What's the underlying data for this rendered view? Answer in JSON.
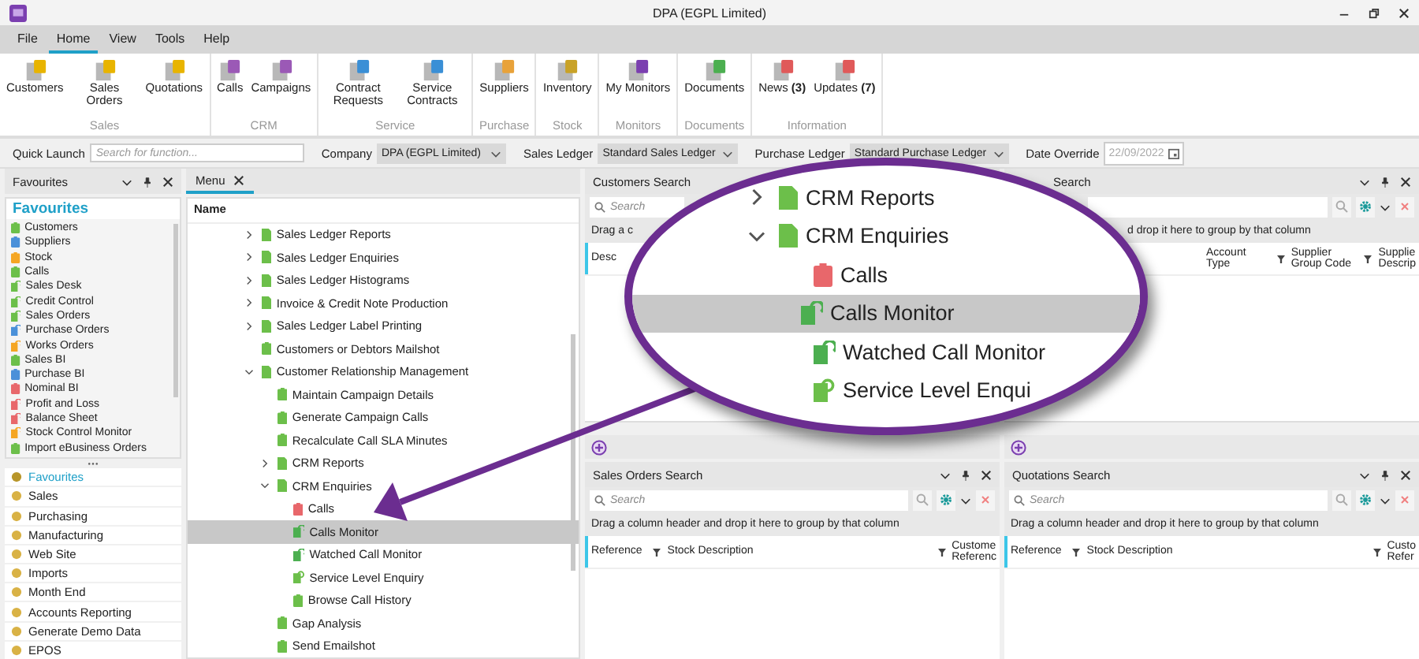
{
  "window": {
    "title": "DPA (EGPL Limited)"
  },
  "menu_tabs": [
    {
      "label": "File",
      "selected": false
    },
    {
      "label": "Home",
      "selected": true
    },
    {
      "label": "View",
      "selected": false
    },
    {
      "label": "Tools",
      "selected": false
    },
    {
      "label": "Help",
      "selected": false
    }
  ],
  "ribbon": {
    "groups": [
      {
        "label": "Sales",
        "buttons": [
          "Customers",
          "Sales Orders",
          "Quotations"
        ]
      },
      {
        "label": "CRM",
        "buttons": [
          "Calls",
          "Campaigns"
        ]
      },
      {
        "label": "Service",
        "buttons": [
          "Contract Requests",
          "Service Contracts"
        ]
      },
      {
        "label": "Purchase",
        "buttons": [
          "Suppliers"
        ]
      },
      {
        "label": "Stock",
        "buttons": [
          "Inventory"
        ]
      },
      {
        "label": "Monitors",
        "buttons": [
          "My Monitors"
        ]
      },
      {
        "label": "Documents",
        "buttons": [
          "Documents"
        ]
      },
      {
        "label": "Information",
        "buttons": [
          "News **(3)**",
          "Updates **(7)**"
        ]
      }
    ]
  },
  "quick_bar": {
    "quick_launch": {
      "label": "Quick Launch",
      "placeholder": "Search for function..."
    },
    "selectors": [
      {
        "label": "Company",
        "value": "DPA (EGPL Limited)"
      },
      {
        "label": "Sales Ledger",
        "value": "Standard Sales Ledger"
      },
      {
        "label": "Purchase Ledger",
        "value": "Standard Purchase Ledger"
      }
    ],
    "date_override": {
      "label": "Date Override",
      "value": "22/09/2022",
      "disabled": true
    }
  },
  "favourites_panel": {
    "title": "Favourites",
    "heading": "Favourites",
    "items": [
      {
        "label": "Customers",
        "kind": "task",
        "color": "#6cbf4a"
      },
      {
        "label": "Suppliers",
        "kind": "task",
        "color": "#4a90d9"
      },
      {
        "label": "Stock",
        "kind": "task",
        "color": "#f5a623"
      },
      {
        "label": "Calls",
        "kind": "task",
        "color": "#6cbf4a"
      },
      {
        "label": "Sales Desk",
        "kind": "monitor",
        "color": "#6cbf4a"
      },
      {
        "label": "Credit Control",
        "kind": "monitor",
        "color": "#6cbf4a"
      },
      {
        "label": "Sales Orders",
        "kind": "monitor",
        "color": "#6cbf4a"
      },
      {
        "label": "Purchase Orders",
        "kind": "monitor",
        "color": "#4a90d9"
      },
      {
        "label": "Works Orders",
        "kind": "monitor",
        "color": "#f5a623"
      },
      {
        "label": "Sales BI",
        "kind": "task",
        "color": "#6cbf4a"
      },
      {
        "label": "Purchase BI",
        "kind": "task",
        "color": "#4a90d9"
      },
      {
        "label": "Nominal BI",
        "kind": "task",
        "color": "#e8676b"
      },
      {
        "label": "Profit and Loss",
        "kind": "monitor",
        "color": "#e8676b"
      },
      {
        "label": "Balance Sheet",
        "kind": "monitor",
        "color": "#e8676b"
      },
      {
        "label": "Stock Control Monitor",
        "kind": "monitor",
        "color": "#f5a623"
      },
      {
        "label": "Import eBusiness Orders",
        "kind": "task",
        "color": "#6cbf4a"
      }
    ],
    "nav": [
      {
        "label": "Favourites",
        "selected": true
      },
      {
        "label": "Sales",
        "selected": false
      },
      {
        "label": "Purchasing",
        "selected": false
      },
      {
        "label": "Manufacturing",
        "selected": false
      },
      {
        "label": "Web Site",
        "selected": false
      },
      {
        "label": "Imports",
        "selected": false
      },
      {
        "label": "Month End",
        "selected": false
      },
      {
        "label": "Accounts Reporting",
        "selected": false
      },
      {
        "label": "Generate Demo Data",
        "selected": false
      },
      {
        "label": "EPOS",
        "selected": false
      }
    ]
  },
  "menu_panel": {
    "tab": "Menu",
    "column": "Name",
    "tree": [
      {
        "label": "Sales Ledger Reports",
        "kind": "folder",
        "expanded": false,
        "selected": false,
        "color": "#6cbf4a"
      },
      {
        "label": "Sales Ledger Enquiries",
        "kind": "folder",
        "expanded": false,
        "selected": false,
        "color": "#6cbf4a"
      },
      {
        "label": "Sales Ledger Histograms",
        "kind": "folder",
        "expanded": false,
        "selected": false,
        "color": "#6cbf4a"
      },
      {
        "label": "Invoice & Credit Note Production",
        "kind": "folder",
        "expanded": false,
        "selected": false,
        "color": "#6cbf4a"
      },
      {
        "label": "Sales Ledger Label Printing",
        "kind": "folder",
        "expanded": false,
        "selected": false,
        "color": "#6cbf4a"
      },
      {
        "label": "Customers or Debtors Mailshot",
        "kind": "task",
        "selected": false,
        "color": "#6cbf4a"
      },
      {
        "label": "Customer Relationship Management",
        "kind": "folder",
        "expanded": true,
        "selected": false,
        "color": "#6cbf4a",
        "children": [
          {
            "label": "Maintain Campaign Details",
            "kind": "task",
            "selected": false,
            "color": "#6cbf4a"
          },
          {
            "label": "Generate Campaign Calls",
            "kind": "task",
            "selected": false,
            "color": "#6cbf4a"
          },
          {
            "label": "Recalculate Call SLA Minutes",
            "kind": "task",
            "selected": false,
            "color": "#6cbf4a"
          },
          {
            "label": "CRM Reports",
            "kind": "folder",
            "expanded": false,
            "selected": false,
            "color": "#6cbf4a"
          },
          {
            "label": "CRM Enquiries",
            "kind": "folder",
            "expanded": true,
            "selected": false,
            "color": "#6cbf4a",
            "children": [
              {
                "label": "Calls",
                "kind": "task",
                "selected": false,
                "color": "#e8676b"
              },
              {
                "label": "Calls Monitor",
                "kind": "monitor",
                "selected": true,
                "color": "#4caf50"
              },
              {
                "label": "Watched Call Monitor",
                "kind": "monitor",
                "selected": false,
                "color": "#4caf50"
              },
              {
                "label": "Service Level Enquiry",
                "kind": "enquiry",
                "selected": false,
                "color": "#6cbf4a"
              },
              {
                "label": "Browse Call History",
                "kind": "task",
                "selected": false,
                "color": "#6cbf4a"
              }
            ]
          },
          {
            "label": "Gap Analysis",
            "kind": "task",
            "selected": false,
            "color": "#6cbf4a"
          },
          {
            "label": "Send Emailshot",
            "kind": "task",
            "selected": false,
            "color": "#6cbf4a"
          }
        ]
      }
    ]
  },
  "search_panels": [
    {
      "title": "Customers Search",
      "search_placeholder": "Search",
      "group_hint": "Drag a c",
      "columns": [
        {
          "label": "Desc",
          "filter": false,
          "wide": false
        }
      ],
      "footer": true
    },
    {
      "title": "Search",
      "group_hint": "d drop it here to group by that column",
      "columns": [
        {
          "label": "Account Type",
          "filter": true,
          "wide": false
        },
        {
          "label": "Supplier Group Code",
          "filter": true,
          "wide": false
        },
        {
          "label": "Supplie Descrip",
          "filter": false,
          "wide": false
        }
      ],
      "footer": true
    },
    {
      "title": "Sales Orders Search",
      "search_placeholder": "Search",
      "group_hint": "Drag a column header and drop it here to group by that column",
      "columns": [
        {
          "label": "Reference",
          "filter": true,
          "wide": false
        },
        {
          "label": "Stock Description",
          "filter": true,
          "wide": true
        },
        {
          "label": "Custome Referenc",
          "filter": false,
          "wide": false
        }
      ],
      "footer": false
    },
    {
      "title": "Quotations Search",
      "search_placeholder": "Search",
      "group_hint": "Drag a column header and drop it here to group by that column",
      "columns": [
        {
          "label": "Reference",
          "filter": true,
          "wide": false
        },
        {
          "label": "Stock Description",
          "filter": true,
          "wide": true
        },
        {
          "label": "Custo Refer",
          "filter": false,
          "wide": false
        }
      ],
      "footer": false
    }
  ],
  "magnifier": {
    "tree": [
      {
        "label": "CRM Reports",
        "kind": "folder",
        "expanded": false,
        "selected": false,
        "color": "#6cbf4a"
      },
      {
        "label": "CRM Enquiries",
        "kind": "folder",
        "expanded": true,
        "selected": false,
        "color": "#6cbf4a",
        "children": [
          {
            "label": "Calls",
            "kind": "task",
            "selected": false,
            "color": "#e8676b"
          },
          {
            "label": "Calls Monitor",
            "kind": "monitor",
            "selected": true,
            "color": "#4caf50"
          },
          {
            "label": "Watched Call Monitor",
            "kind": "monitor",
            "selected": false,
            "color": "#4caf50"
          },
          {
            "label": "Service Level Enqui",
            "kind": "enquiry",
            "selected": false,
            "color": "#6cbf4a"
          }
        ]
      }
    ]
  }
}
